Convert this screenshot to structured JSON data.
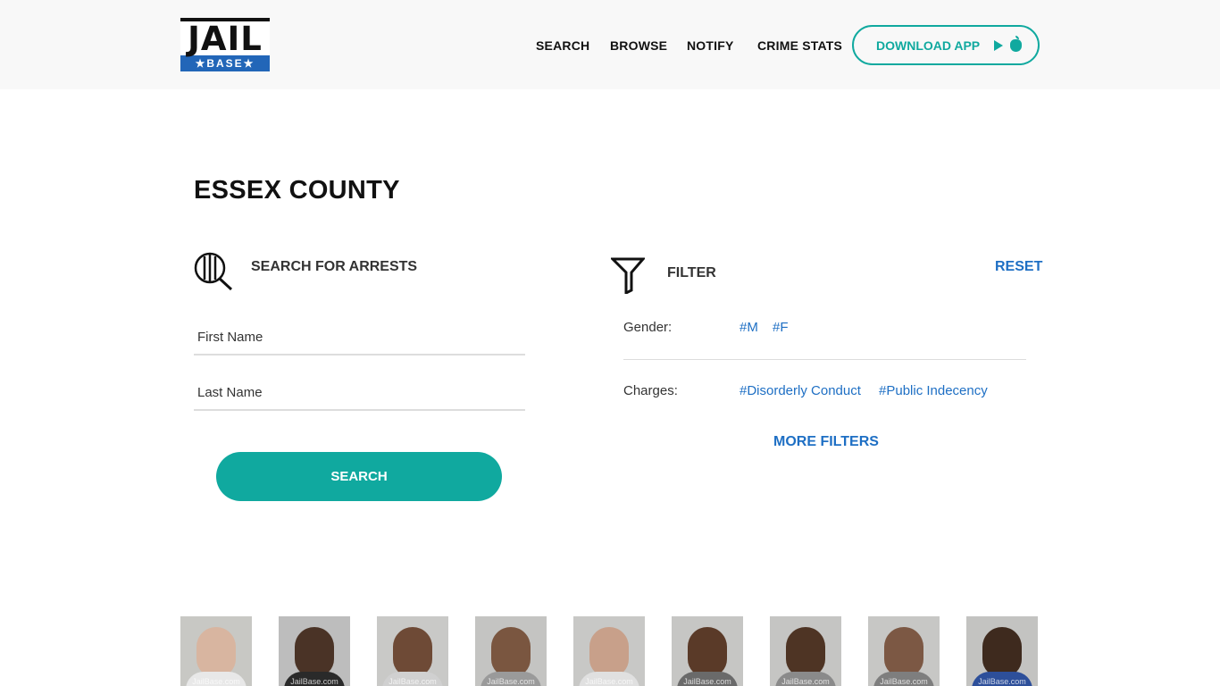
{
  "header": {
    "logo_top": "JAIL",
    "logo_bottom": "★BASE★",
    "nav": {
      "search": "SEARCH",
      "browse": "BROWSE",
      "notify": "NOTIFY",
      "crime_stats": "CRIME STATS"
    },
    "download_label": "DOWNLOAD APP",
    "download_icons": [
      "google-play-icon",
      "apple-icon"
    ]
  },
  "page_title": "ESSEX COUNTY",
  "search_panel": {
    "heading": "SEARCH FOR ARRESTS",
    "first_name_placeholder": "First Name",
    "last_name_placeholder": "Last Name",
    "search_button": "SEARCH"
  },
  "filter_panel": {
    "heading": "FILTER",
    "reset": "RESET",
    "gender_label": "Gender:",
    "gender_tags": [
      "#M",
      "#F"
    ],
    "charges_label": "Charges:",
    "charge_tags": [
      "#Disorderly Conduct",
      "#Public Indecency"
    ],
    "more_filters": "MORE FILTERS"
  },
  "mugshots": {
    "watermark": "JailBase.com",
    "count": 9
  },
  "colors": {
    "accent_teal": "#10a99f",
    "link_blue": "#1e6fc4",
    "logo_blue": "#2266b8",
    "header_bg": "#f8f8f8"
  }
}
